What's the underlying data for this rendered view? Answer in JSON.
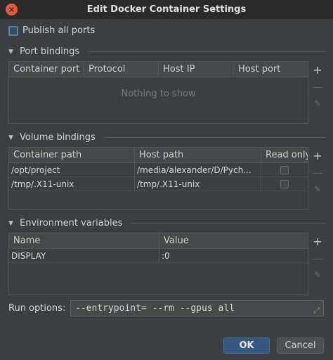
{
  "window": {
    "title": "Edit Docker Container Settings",
    "close_glyph": "×"
  },
  "publish_all_ports": {
    "label": "Publish all ports",
    "checked": false
  },
  "port_bindings": {
    "title": "Port bindings",
    "columns": [
      "Container port",
      "Protocol",
      "Host IP",
      "Host port"
    ],
    "empty_text": "Nothing to show"
  },
  "volume_bindings": {
    "title": "Volume bindings",
    "columns": [
      "Container path",
      "Host path",
      "Read only"
    ],
    "rows": [
      {
        "container_path": "/opt/project",
        "host_path": "/media/alexander/D/Pych...",
        "read_only": false
      },
      {
        "container_path": "/tmp/.X11-unix",
        "host_path": "/tmp/.X11-unix",
        "read_only": false
      }
    ]
  },
  "environment_variables": {
    "title": "Environment variables",
    "columns": [
      "Name",
      "Value"
    ],
    "rows": [
      {
        "name": "DISPLAY",
        "value": ":0"
      }
    ]
  },
  "tools": {
    "add": "+",
    "remove": "—",
    "edit": "✎"
  },
  "run_options": {
    "label": "Run options:",
    "value": "--entrypoint= --rm --gpus all",
    "expand_glyph": "⤢"
  },
  "buttons": {
    "ok": "OK",
    "cancel": "Cancel"
  },
  "colors": {
    "background": "#3c3f41",
    "accent": "#365880",
    "focus": "#4c83c3"
  }
}
